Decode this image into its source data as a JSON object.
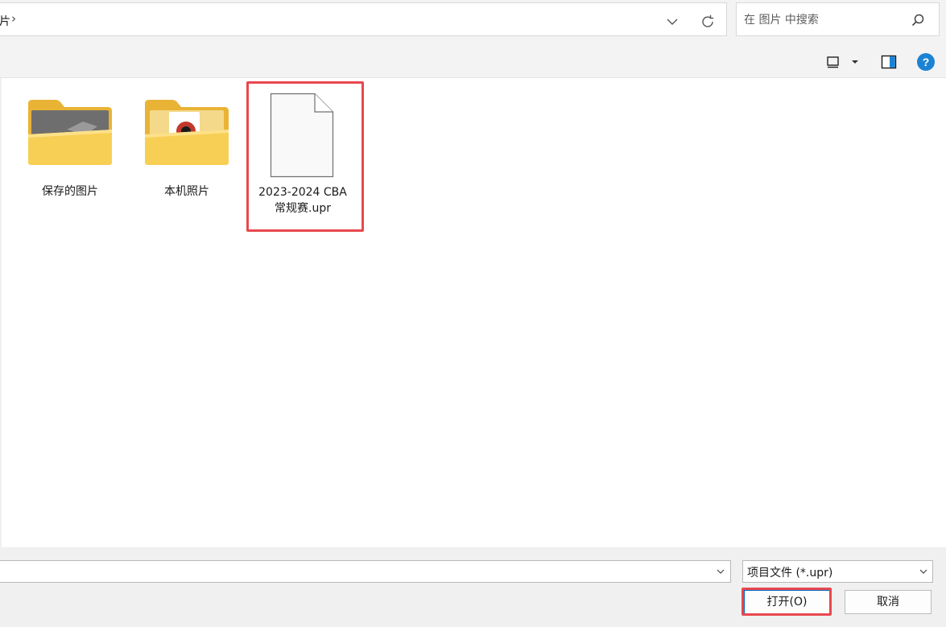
{
  "address_bar": {
    "crumb_partial": "片",
    "crumb_separator": "›"
  },
  "search": {
    "placeholder": "在 图片 中搜索"
  },
  "toolbar": {
    "help_label": "?"
  },
  "items": [
    {
      "name": "保存的图片",
      "type": "folder"
    },
    {
      "name": "本机照片",
      "type": "folder"
    },
    {
      "name_line1": "2023-2024 CBA",
      "name_line2": "常规赛.upr",
      "type": "file"
    }
  ],
  "footer": {
    "filename_value": "",
    "filetype_selected": "项目文件 (*.upr)",
    "open_label": "打开(O)",
    "cancel_label": "取消"
  },
  "colors": {
    "highlight": "#e8484f",
    "folder": "#f5c84c",
    "accent": "#1c83d4"
  }
}
